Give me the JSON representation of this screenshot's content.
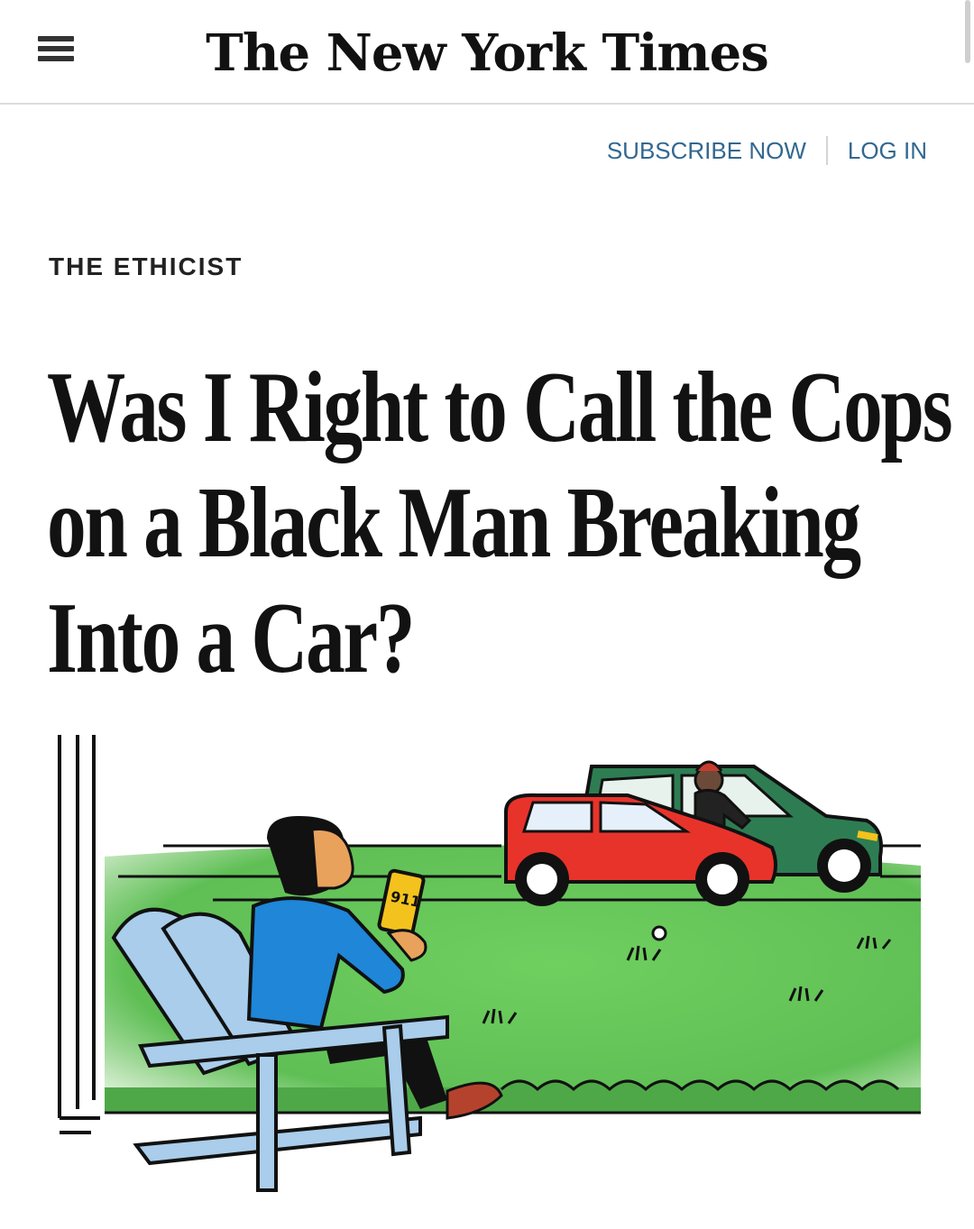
{
  "header": {
    "masthead": "The New York Times",
    "menu_icon": "hamburger-menu-icon"
  },
  "account": {
    "subscribe_label": "SUBSCRIBE NOW",
    "login_label": "LOG IN",
    "link_color": "#326891"
  },
  "article": {
    "kicker": "THE ETHICIST",
    "headline_lines": [
      "Was I Right to Call the Cops",
      "on a Black Man Breaking",
      "Into a Car?"
    ]
  },
  "illustration": {
    "phone_text": "911",
    "colors": {
      "grass": "#5fbf55",
      "red_car": "#e8332b",
      "green_car": "#2e7d52",
      "chair": "#a9cdea",
      "shirt": "#1f86d8",
      "phone": "#f4c21c"
    }
  }
}
